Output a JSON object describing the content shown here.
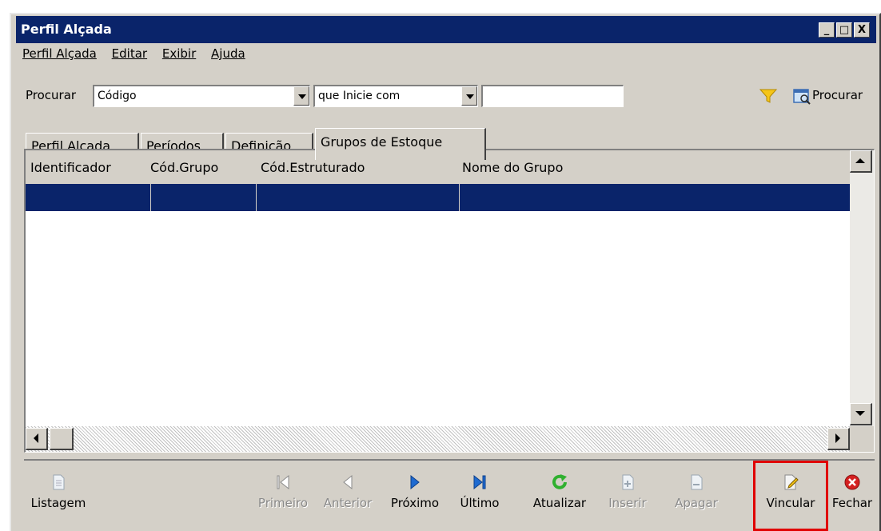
{
  "window": {
    "title": "Perfil Alçada",
    "controls": {
      "minimize": "_",
      "maximize": "□",
      "close": "X"
    }
  },
  "menu": [
    "Perfil Alçada",
    "Editar",
    "Exibir",
    "Ajuda"
  ],
  "search": {
    "label": "Procurar",
    "field_value": "Código",
    "condition_value": "que Inicie com",
    "text_value": "",
    "button_label": "Procurar"
  },
  "tabs": [
    "Perfil Alçada",
    "Períodos",
    "Definição",
    "Grupos de Estoque"
  ],
  "active_tab": "Grupos de Estoque",
  "grid": {
    "columns": [
      "Identificador",
      "Cód.Grupo",
      "Cód.Estruturado",
      "Nome do Grupo"
    ],
    "rows": [
      [
        "",
        "",
        "",
        ""
      ]
    ]
  },
  "toolbar": {
    "listagem": "Listagem",
    "primeiro": "Primeiro",
    "anterior": "Anterior",
    "proximo": "Próximo",
    "ultimo": "Último",
    "atualizar": "Atualizar",
    "inserir": "Inserir",
    "apagar": "Apagar",
    "vincular": "Vincular",
    "fechar": "Fechar"
  },
  "colors": {
    "titlebar": "#0a246a",
    "selection": "#0a246a",
    "face": "#d4d0c8",
    "highlight_box": "#e00000",
    "nav_blue": "#1e6ad0",
    "refresh_green": "#2fb02f",
    "close_red": "#d42020"
  }
}
